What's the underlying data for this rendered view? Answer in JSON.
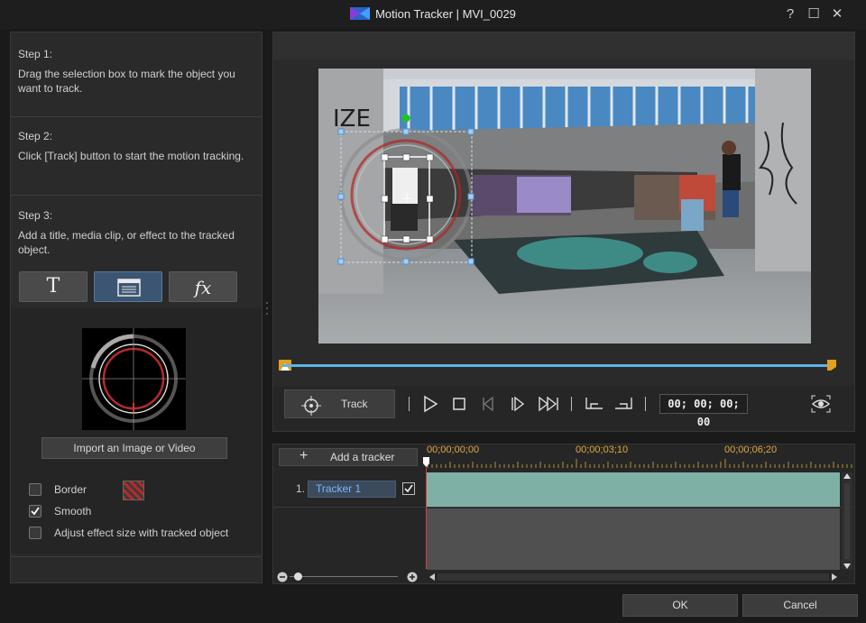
{
  "window": {
    "title": "Motion Tracker  |  MVI_0029",
    "help_glyph": "?",
    "maximize_glyph": "☐",
    "close_glyph": "✕"
  },
  "steps": [
    {
      "title": "Step 1:",
      "text": "Drag the selection box to mark the object you want to track."
    },
    {
      "title": "Step 2:",
      "text": "Click [Track] button to start the motion tracking."
    },
    {
      "title": "Step 3:",
      "text": "Add a title, media clip, or effect to the tracked object."
    }
  ],
  "tools": {
    "title_glyph": "T",
    "fx_glyph": "fx"
  },
  "import_button": "Import an Image or Video",
  "options": {
    "border_label": "Border",
    "smooth_label": "Smooth",
    "adjust_label": "Adjust effect size with tracked object",
    "border_checked": false,
    "smooth_checked": true,
    "adjust_checked": false
  },
  "controls": {
    "track_label": "Track",
    "timecode": "00; 00; 00; 00"
  },
  "tracker": {
    "add_label": "Add a tracker",
    "ruler_labels": [
      "00;00;00;00",
      "00;00;03;10",
      "00;00;06;20"
    ],
    "row_number": "1.",
    "name": "Tracker 1",
    "checked": true
  },
  "dialog": {
    "ok_label": "OK",
    "cancel_label": "Cancel"
  },
  "colors": {
    "accent_blue": "#5bb4e8",
    "track_block": "#7fb0a6",
    "playhead": "#e03a3a",
    "ruler_text": "#e0a93a"
  }
}
